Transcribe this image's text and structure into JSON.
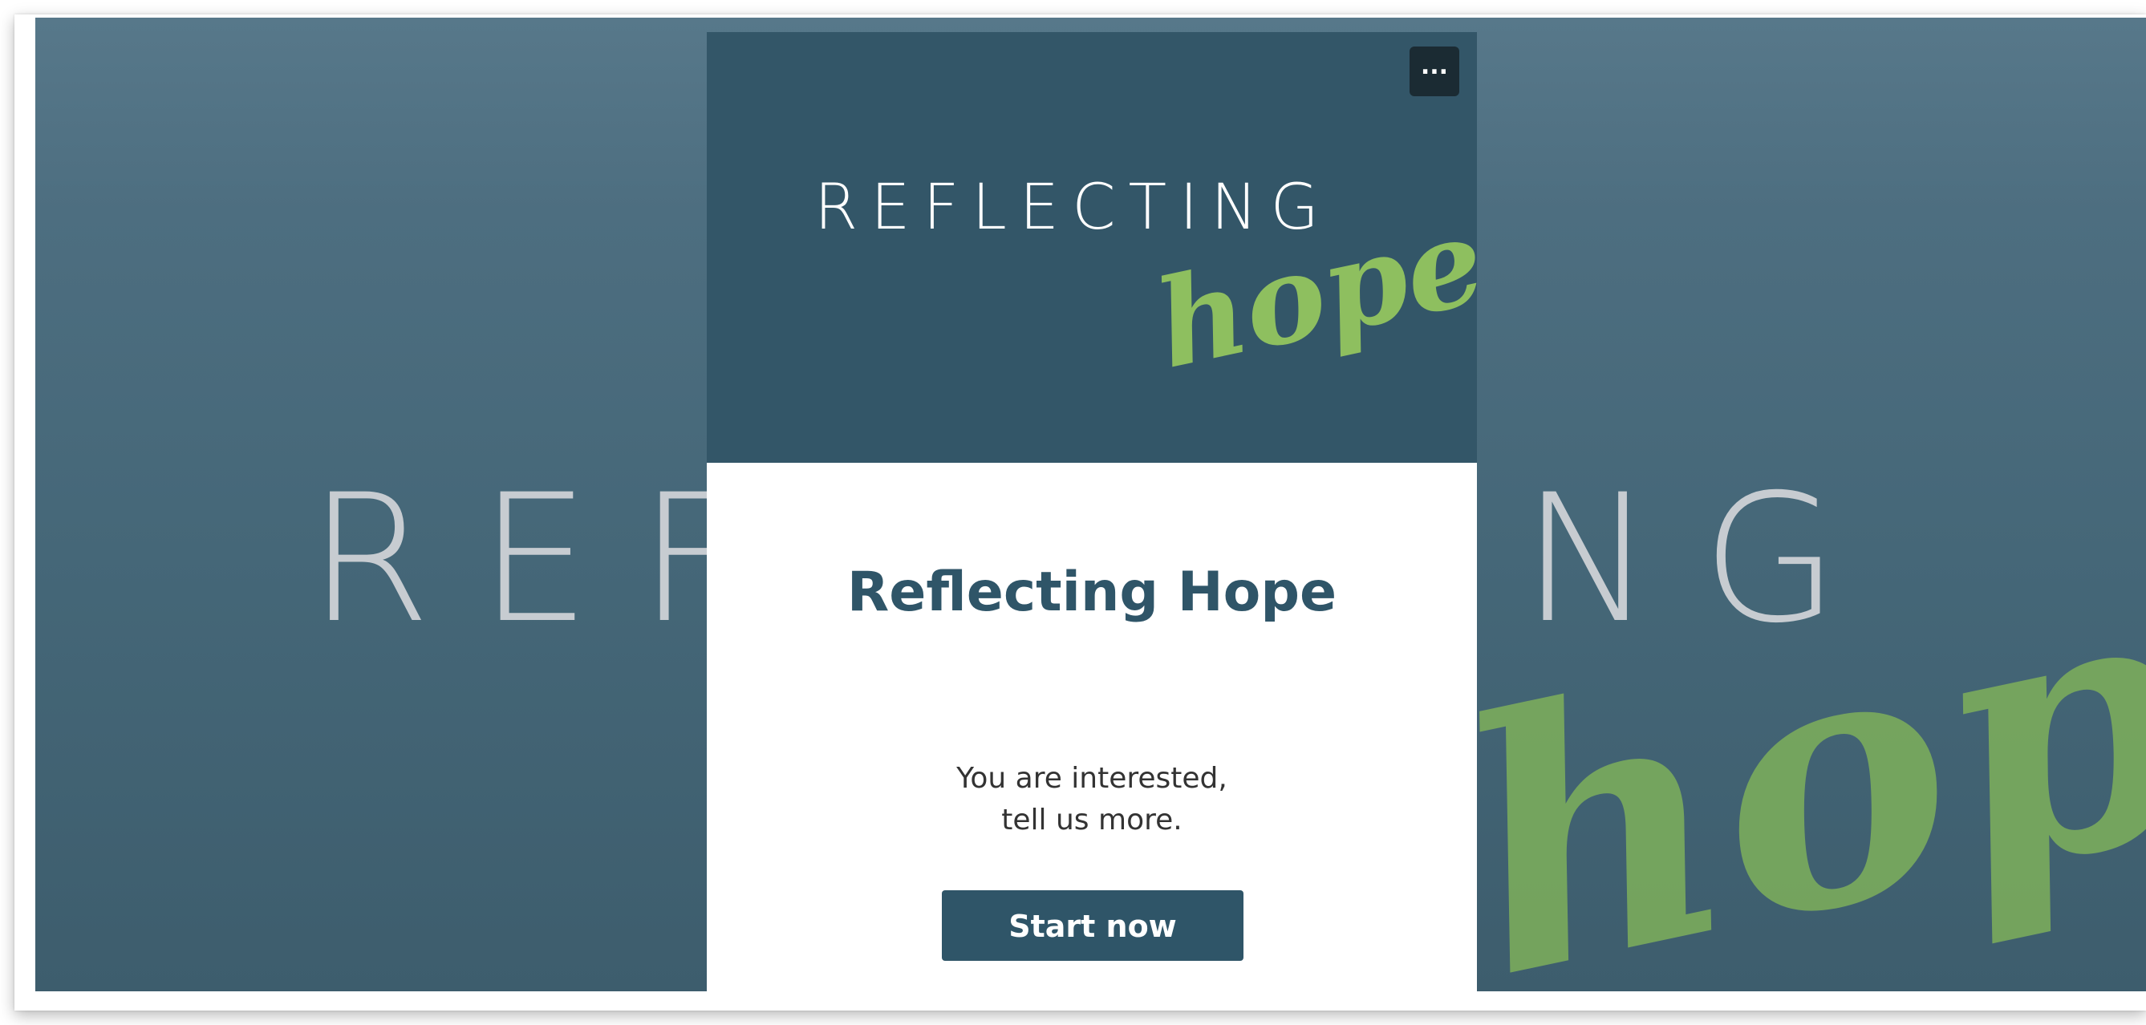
{
  "background": {
    "word": "REFLECTING",
    "script": "hope"
  },
  "card": {
    "menu_button_label": "...",
    "logo": {
      "word": "REFLECTING",
      "script": "hope"
    },
    "title": "Reflecting Hope",
    "description_line1": "You are interested,",
    "description_line2": "tell us more.",
    "start_button_label": "Start now"
  },
  "colors": {
    "header": "#335668",
    "accent_green": "#8ebf5f",
    "title": "#2f5568",
    "button": "#2f5568",
    "menu_button": "#1b2b33"
  },
  "icons": {
    "menu": "more-horizontal-icon"
  }
}
